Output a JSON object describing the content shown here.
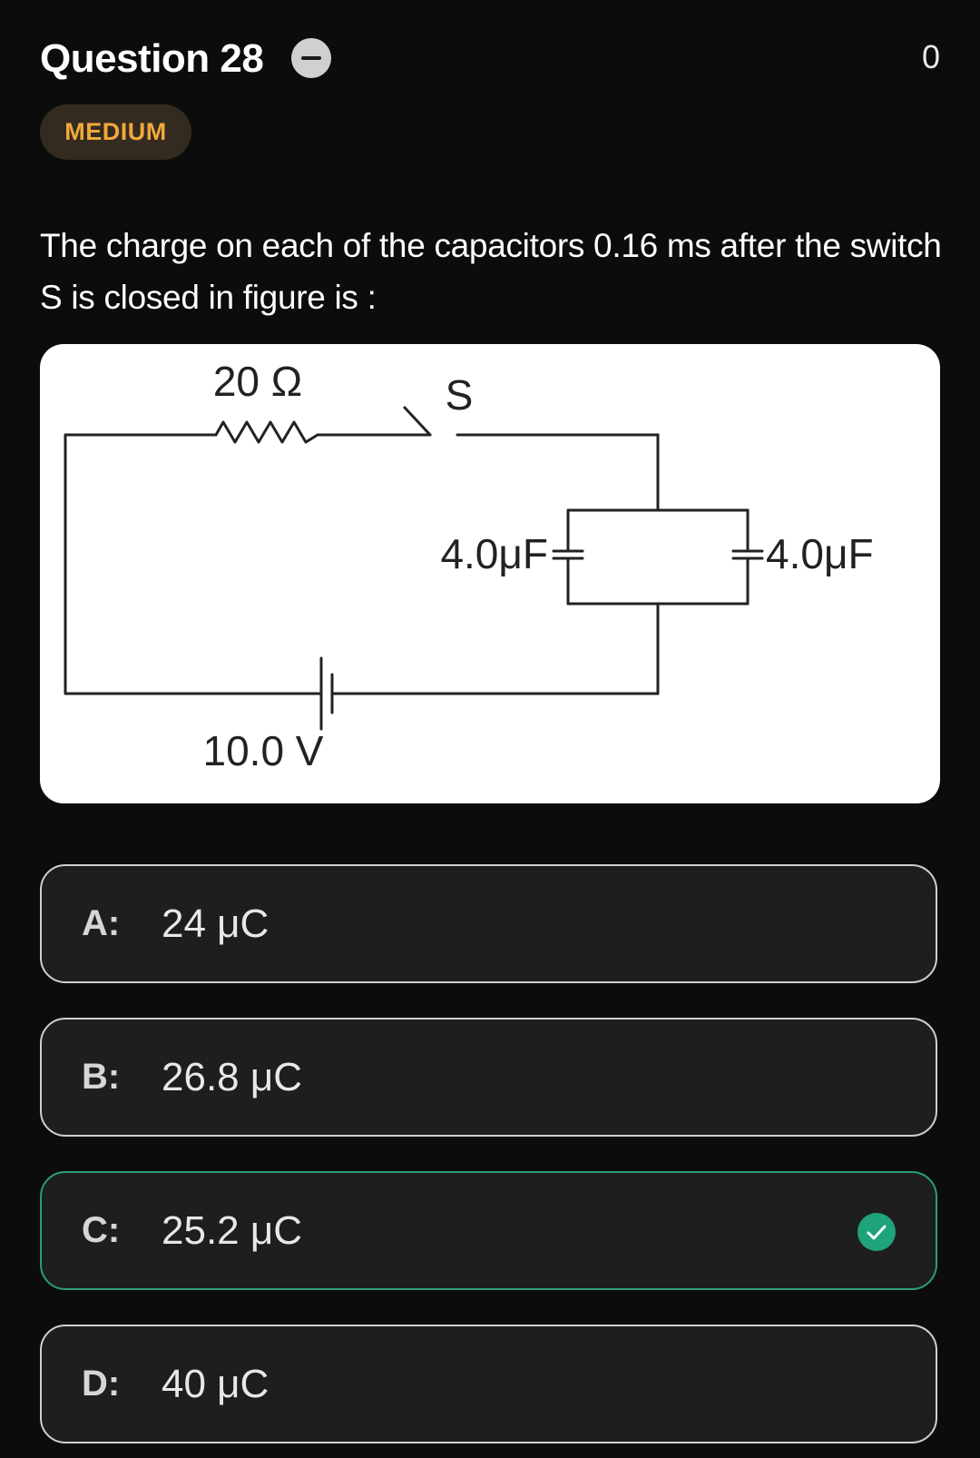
{
  "header": {
    "title": "Question 28",
    "score": "0",
    "difficulty": "MEDIUM"
  },
  "question": {
    "text": "The charge on each of the capacitors 0.16 ms after the switch S is closed in figure is :"
  },
  "figure": {
    "resistor_label": "20 Ω",
    "switch_label": "S",
    "cap_left_label": "4.0μF",
    "cap_right_label": "4.0μF",
    "battery_label": "10.0 V"
  },
  "options": [
    {
      "letter": "A:",
      "text": "24 μC",
      "correct": false
    },
    {
      "letter": "B:",
      "text": "26.8 μC",
      "correct": false
    },
    {
      "letter": "C:",
      "text": "25.2 μC",
      "correct": true
    },
    {
      "letter": "D:",
      "text": "40 μC",
      "correct": false
    }
  ],
  "colors": {
    "background": "#0c0c0c",
    "badge_text": "#f0a83a",
    "correct": "#1fa37a"
  }
}
